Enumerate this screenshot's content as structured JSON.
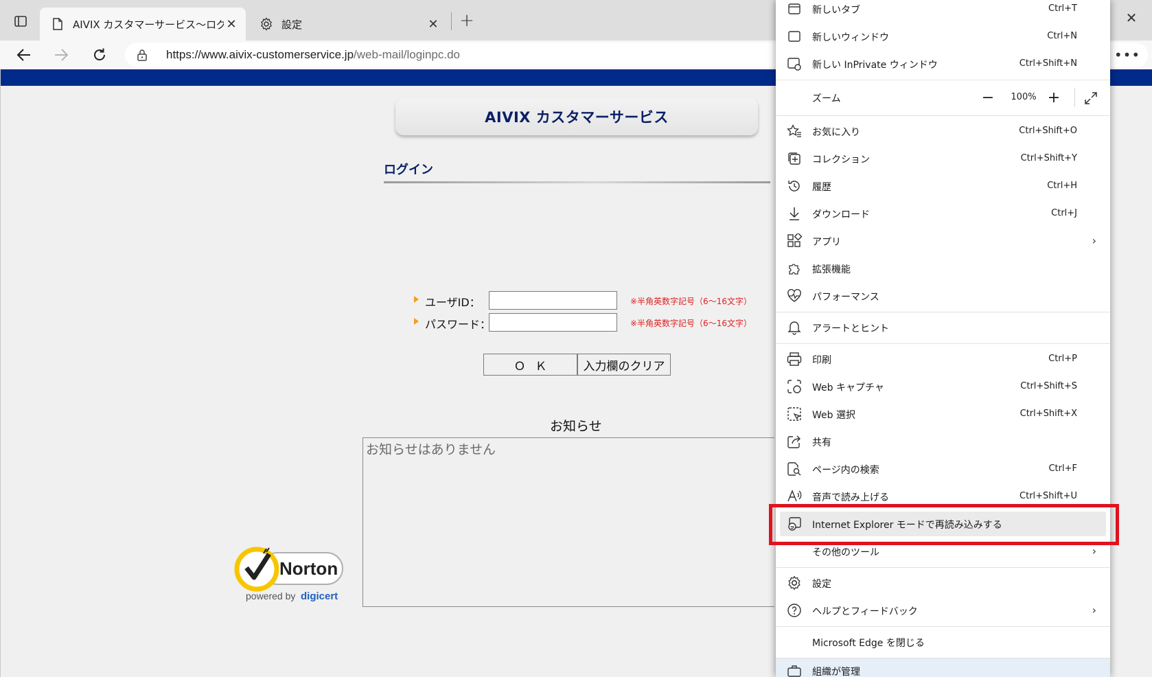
{
  "tabs": [
    {
      "title": "AIVIX カスタマーサービス～ログイン～",
      "icon": "page-icon"
    },
    {
      "title": "設定",
      "icon": "gear-icon"
    }
  ],
  "address_bar": {
    "url_host": "https://www.aivix-customerservice.jp",
    "url_path": "/web-mail/loginpc.do"
  },
  "page": {
    "service_title": "AIVIX カスタマーサービス",
    "login_heading": "ログイン",
    "userid_label": "ユーザID：",
    "password_label": "パスワード：",
    "userid_note": "※半角英数字記号（6～16文字）",
    "password_note": "※半角英数字記号（6～16文字）",
    "ok_button": "ＯＫ",
    "clear_button": "入力欄のクリア",
    "notice_heading": "お知らせ",
    "notice_text": "お知らせはありません",
    "norton": {
      "brand": "Norton",
      "powered_by": "powered by",
      "cert": "digicert"
    }
  },
  "menu": {
    "new_tab": {
      "label": "新しいタブ",
      "shortcut": "Ctrl+T"
    },
    "new_window": {
      "label": "新しいウィンドウ",
      "shortcut": "Ctrl+N"
    },
    "new_inprivate": {
      "label": "新しい InPrivate ウィンドウ",
      "shortcut": "Ctrl+Shift+N"
    },
    "zoom": {
      "label": "ズーム",
      "value": "100%"
    },
    "favorites": {
      "label": "お気に入り",
      "shortcut": "Ctrl+Shift+O"
    },
    "collections": {
      "label": "コレクション",
      "shortcut": "Ctrl+Shift+Y"
    },
    "history": {
      "label": "履歴",
      "shortcut": "Ctrl+H"
    },
    "downloads": {
      "label": "ダウンロード",
      "shortcut": "Ctrl+J"
    },
    "apps": {
      "label": "アプリ"
    },
    "extensions": {
      "label": "拡張機能"
    },
    "performance": {
      "label": "パフォーマンス"
    },
    "alerts": {
      "label": "アラートとヒント"
    },
    "print": {
      "label": "印刷",
      "shortcut": "Ctrl+P"
    },
    "web_capture": {
      "label": "Web キャプチャ",
      "shortcut": "Ctrl+Shift+S"
    },
    "web_select": {
      "label": "Web 選択",
      "shortcut": "Ctrl+Shift+X"
    },
    "share": {
      "label": "共有"
    },
    "find": {
      "label": "ページ内の検索",
      "shortcut": "Ctrl+F"
    },
    "read_aloud": {
      "label": "音声で読み上げる",
      "shortcut": "Ctrl+Shift+U"
    },
    "ie_mode": {
      "label": "Internet Explorer モードで再読み込みする"
    },
    "more_tools": {
      "label": "その他のツール"
    },
    "settings": {
      "label": "設定"
    },
    "help": {
      "label": "ヘルプとフィードバック"
    },
    "close_edge": {
      "label": "Microsoft Edge を閉じる"
    },
    "org_managed": {
      "label": "組織が管理"
    }
  },
  "colors": {
    "page_topbar": "#002b8a",
    "title_navy": "#0b1f66",
    "note_red": "#e02020",
    "highlight_red": "#e0121f"
  }
}
